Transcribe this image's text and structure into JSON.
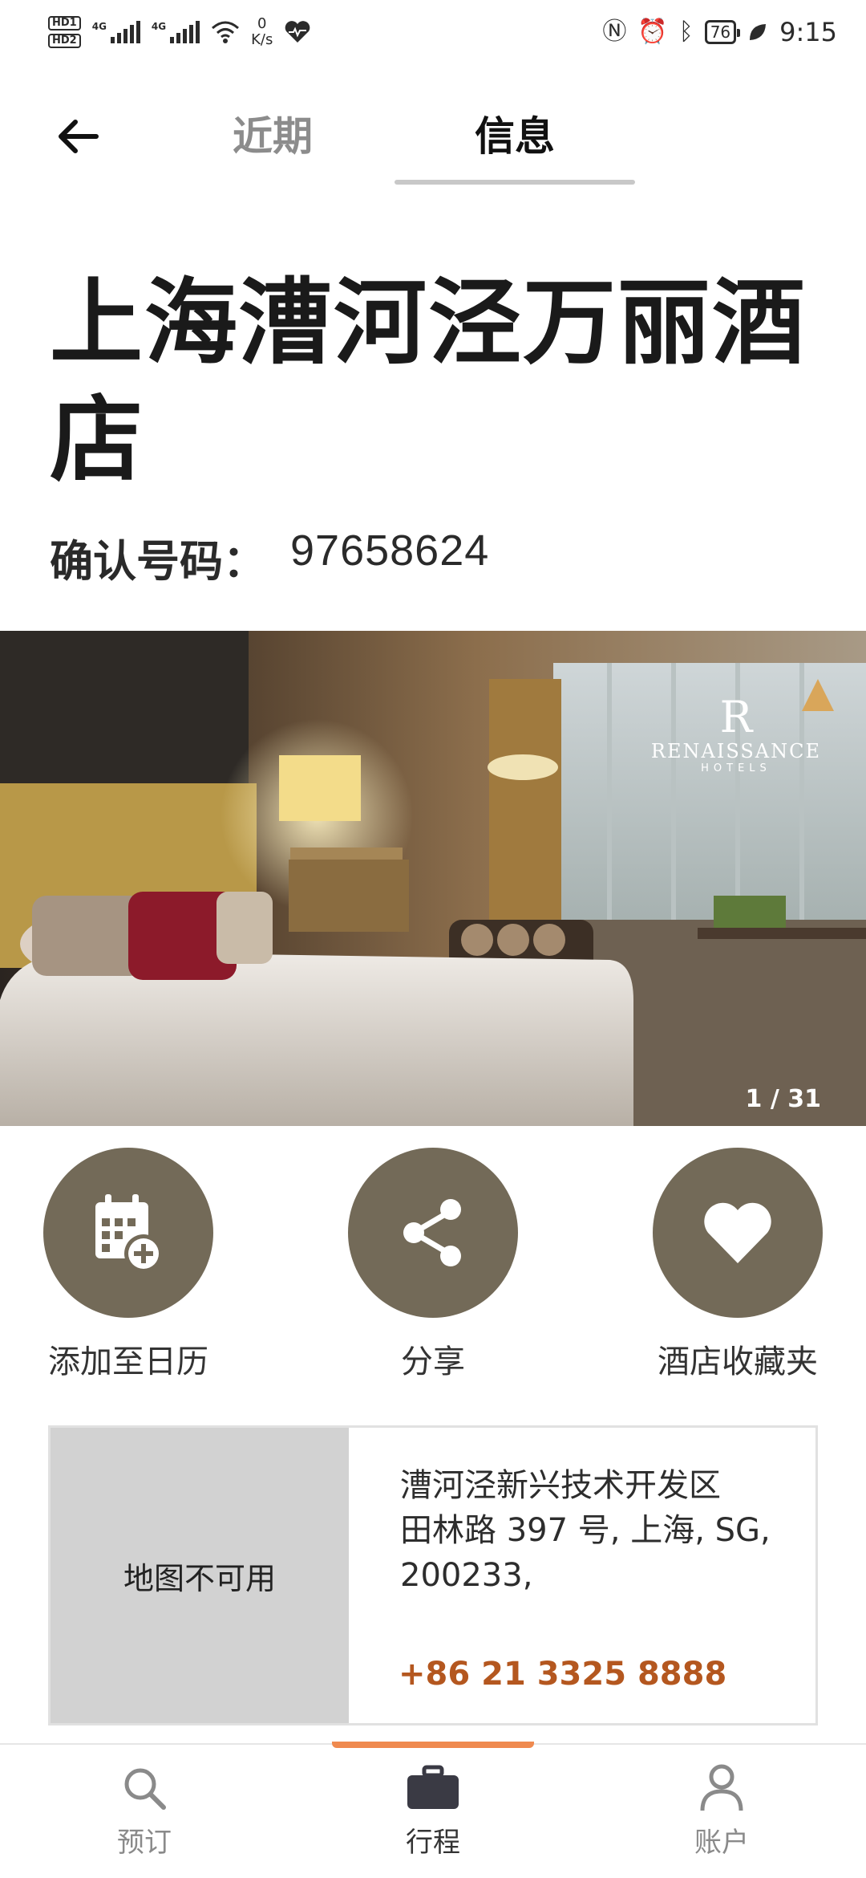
{
  "status_bar": {
    "hd1": "HD1",
    "hd2": "HD2",
    "sig1_tag": "4G",
    "sig2_tag": "4G",
    "net_speed": "0",
    "net_unit": "K/s",
    "battery": "76",
    "time": "9:15"
  },
  "header": {
    "tab_recent": "近期",
    "tab_info": "信息"
  },
  "hotel": {
    "title": "上海漕河泾万丽酒店",
    "confirm_label": "确认号码：",
    "confirm_number": "97658624"
  },
  "photo": {
    "brand_initial": "R",
    "brand_name": "RENAISSANCE",
    "brand_sub": "HOTELS",
    "counter": "1 / 31"
  },
  "actions": {
    "calendar": "添加至日历",
    "share": "分享",
    "favorites": "酒店收藏夹"
  },
  "info": {
    "map_unavailable": "地图不可用",
    "address_line1": "漕河泾新兴技术开发区",
    "address_line2": "田林路 397 号, 上海, SG,",
    "address_line3": "200233,",
    "phone": "+86 21 3325 8888"
  },
  "bottom_nav": {
    "book": "预订",
    "trips": "行程",
    "account": "账户"
  },
  "colors": {
    "action_circle": "#736a58",
    "phone": "#b4571f",
    "nav_indicator": "#ef8a4f"
  }
}
